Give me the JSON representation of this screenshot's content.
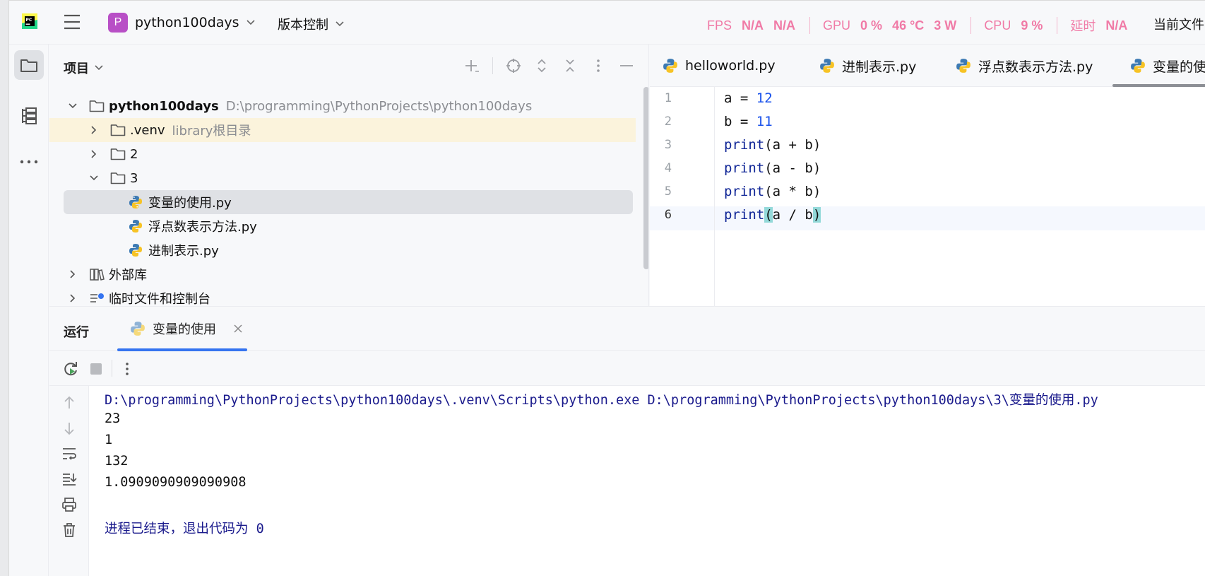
{
  "titlebar": {
    "project_badge": "P",
    "project_name": "python100days",
    "vcs_label": "版本控制",
    "current_file_label": "当前文件",
    "perf": {
      "fps_label": "FPS",
      "fps_value1": "N/A",
      "fps_value2": "N/A",
      "gpu_label": "GPU",
      "gpu_usage": "0 %",
      "gpu_temp": "46 °C",
      "gpu_power": "3 W",
      "cpu_label": "CPU",
      "cpu_usage": "9 %",
      "latency_label": "延时",
      "latency_value": "N/A"
    }
  },
  "project_panel": {
    "title": "项目",
    "tree": [
      {
        "label": "python100days",
        "hint": "D:\\programming\\PythonProjects\\python100days"
      },
      {
        "label": ".venv",
        "hint": "library根目录"
      },
      {
        "label": "2"
      },
      {
        "label": "3"
      },
      {
        "label": "变量的使用.py"
      },
      {
        "label": "浮点数表示方法.py"
      },
      {
        "label": "进制表示.py"
      },
      {
        "label": "外部库"
      },
      {
        "label": "临时文件和控制台"
      }
    ]
  },
  "editor": {
    "tabs": [
      {
        "label": "helloworld.py"
      },
      {
        "label": "进制表示.py"
      },
      {
        "label": "浮点数表示方法.py"
      },
      {
        "label": "变量的使用.py"
      }
    ],
    "line_numbers": [
      "1",
      "2",
      "3",
      "4",
      "5",
      "6"
    ],
    "code": {
      "l1_var": "a",
      "l1_eq": " = ",
      "l1_num": "12",
      "l2_var": "b",
      "l2_eq": " = ",
      "l2_num": "11",
      "l3_fn": "print",
      "l3_rest": "(a + b)",
      "l4_fn": "print",
      "l4_rest": "(a - b)",
      "l5_fn": "print",
      "l5_rest": "(a * b)",
      "l6_fn": "print",
      "l6_open": "(",
      "l6_mid": "a / b",
      "l6_close": ")"
    }
  },
  "run_panel": {
    "title": "运行",
    "tab_label": "变量的使用",
    "console": {
      "command": "D:\\programming\\PythonProjects\\python100days\\.venv\\Scripts\\python.exe D:\\programming\\PythonProjects\\python100days\\3\\变量的使用.py",
      "output": [
        "23",
        "1",
        "132",
        "1.0909090909090908"
      ],
      "exit_message": "进程已结束，退出代码为 0"
    }
  }
}
